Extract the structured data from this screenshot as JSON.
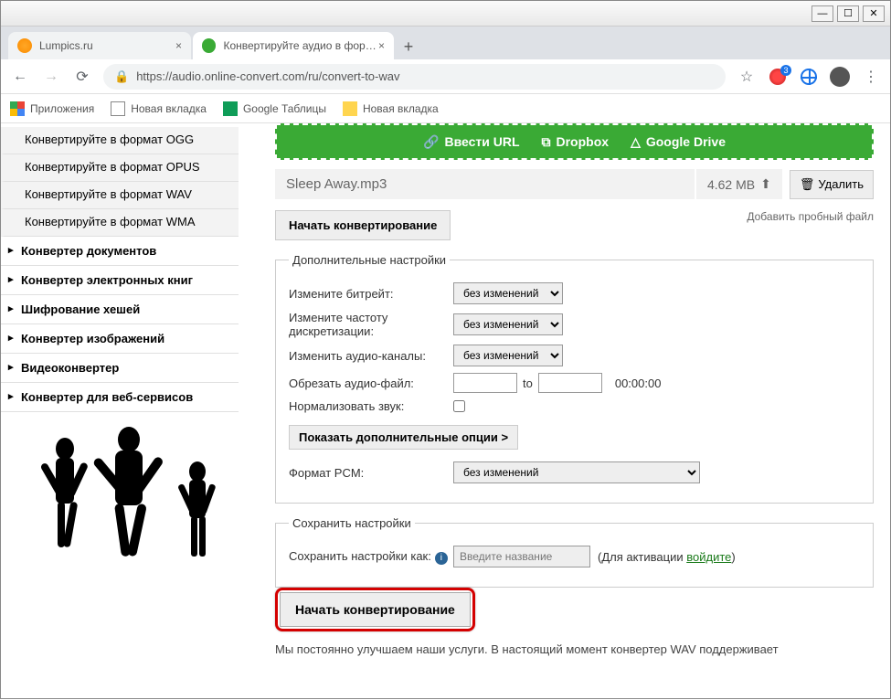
{
  "window": {
    "min": "—",
    "max": "☐",
    "close": "✕"
  },
  "tabs": {
    "t0": "Lumpics.ru",
    "t1": "Конвертируйте аудио в формат"
  },
  "url": "https://audio.online-convert.com/ru/convert-to-wav",
  "bookmarks": {
    "apps": "Приложения",
    "newtab1": "Новая вкладка",
    "sheets": "Google Таблицы",
    "newtab2": "Новая вкладка"
  },
  "sidebar": {
    "ogg": "Конвертируйте в формат OGG",
    "opus": "Конвертируйте в формат OPUS",
    "wav": "Конвертируйте в формат WAV",
    "wma": "Конвертируйте в формат WMA",
    "docs": "Конвертер документов",
    "ebook": "Конвертер электронных книг",
    "hash": "Шифрование хешей",
    "img": "Конвертер изображений",
    "video": "Видеоконвертер",
    "web": "Конвертер для веб-сервисов"
  },
  "upload": {
    "url": "Ввести URL",
    "dropbox": "Dropbox",
    "gdrive": "Google Drive"
  },
  "file": {
    "name": "Sleep Away.mp3",
    "size": "4.62 MB",
    "delete": "Удалить"
  },
  "actions": {
    "start": "Начать конвертирование",
    "addtrial": "Добавить пробный файл"
  },
  "fs": {
    "legend": "Дополнительные настройки",
    "bitrate": "Измените битрейт:",
    "freq": "Измените частоту дискретизации:",
    "channels": "Изменить аудио-каналы:",
    "trim": "Обрезать аудио-файл:",
    "to": "to",
    "time": "00:00:00",
    "norm": "Нормализовать звук:",
    "more": "Показать дополнительные опции >",
    "pcm": "Формат PCM:",
    "nochange": "без изменений"
  },
  "save": {
    "legend": "Сохранить настройки",
    "label": "Сохранить настройки как:",
    "placeholder": "Введите название",
    "act1": "(Для активации ",
    "login": "войдите",
    "act2": ")"
  },
  "footer": "Мы постоянно улучшаем наши услуги. В настоящий момент конвертер WAV поддерживает"
}
